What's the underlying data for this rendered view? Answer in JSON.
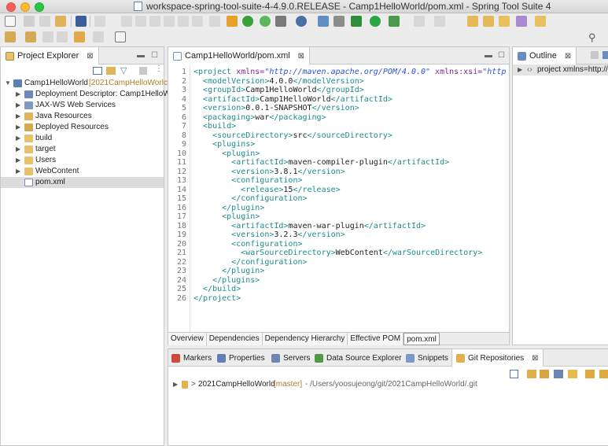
{
  "window": {
    "title": "workspace-spring-tool-suite-4-4.9.0.RELEASE - Camp1HelloWorld/pom.xml - Spring Tool Suite 4"
  },
  "project_explorer": {
    "tab_label": "Project Explorer",
    "close": "⊠",
    "root": {
      "label": "Camp1HelloWorld",
      "repo": "[2021CampHelloWorlc"
    },
    "items": [
      {
        "label": "Deployment Descriptor: Camp1HelloW"
      },
      {
        "label": "JAX-WS Web Services"
      },
      {
        "label": "Java Resources"
      },
      {
        "label": "Deployed Resources"
      },
      {
        "label": "build"
      },
      {
        "label": "target"
      },
      {
        "label": "Users"
      },
      {
        "label": "WebContent"
      },
      {
        "label": "pom.xml"
      }
    ]
  },
  "editor": {
    "tab_label": "Camp1HelloWorld/pom.xml",
    "close": "⊠",
    "lines": [
      {
        "n": "1",
        "c": [
          [
            "tag",
            "<project "
          ],
          [
            "attr",
            "xmlns="
          ],
          [
            "str",
            "\"http://maven.apache.org/POM/4.0.0\""
          ],
          [
            "attr",
            " xmlns:xsi="
          ],
          [
            "str",
            "\"http"
          ]
        ]
      },
      {
        "n": "2",
        "c": [
          [
            "txt",
            "  "
          ],
          [
            "tag",
            "<modelVersion>"
          ],
          [
            "txt",
            "4.0.0"
          ],
          [
            "tag",
            "</modelVersion>"
          ]
        ]
      },
      {
        "n": "3",
        "c": [
          [
            "txt",
            "  "
          ],
          [
            "tag",
            "<groupId>"
          ],
          [
            "txt",
            "Camp1HelloWorld"
          ],
          [
            "tag",
            "</groupId>"
          ]
        ]
      },
      {
        "n": "4",
        "c": [
          [
            "txt",
            "  "
          ],
          [
            "tag",
            "<artifactId>"
          ],
          [
            "txt",
            "Camp1HelloWorld"
          ],
          [
            "tag",
            "</artifactId>"
          ]
        ]
      },
      {
        "n": "5",
        "c": [
          [
            "txt",
            "  "
          ],
          [
            "tag",
            "<version>"
          ],
          [
            "txt",
            "0.0.1-SNAPSHOT"
          ],
          [
            "tag",
            "</version>"
          ]
        ]
      },
      {
        "n": "6",
        "c": [
          [
            "txt",
            "  "
          ],
          [
            "tag",
            "<packaging>"
          ],
          [
            "txt",
            "war"
          ],
          [
            "tag",
            "</packaging>"
          ]
        ]
      },
      {
        "n": "7",
        "c": [
          [
            "txt",
            "  "
          ],
          [
            "tag",
            "<build>"
          ]
        ]
      },
      {
        "n": "8",
        "c": [
          [
            "txt",
            "    "
          ],
          [
            "tag",
            "<sourceDirectory>"
          ],
          [
            "txt",
            "src"
          ],
          [
            "tag",
            "</sourceDirectory>"
          ]
        ]
      },
      {
        "n": "9",
        "c": [
          [
            "txt",
            "    "
          ],
          [
            "tag",
            "<plugins>"
          ]
        ]
      },
      {
        "n": "10",
        "c": [
          [
            "txt",
            "      "
          ],
          [
            "tag",
            "<plugin>"
          ]
        ]
      },
      {
        "n": "11",
        "c": [
          [
            "txt",
            "        "
          ],
          [
            "tag",
            "<artifactId>"
          ],
          [
            "txt",
            "maven-compiler-plugin"
          ],
          [
            "tag",
            "</artifactId>"
          ]
        ]
      },
      {
        "n": "12",
        "c": [
          [
            "txt",
            "        "
          ],
          [
            "tag",
            "<version>"
          ],
          [
            "txt",
            "3.8.1"
          ],
          [
            "tag",
            "</version>"
          ]
        ]
      },
      {
        "n": "13",
        "c": [
          [
            "txt",
            "        "
          ],
          [
            "tag",
            "<configuration>"
          ]
        ]
      },
      {
        "n": "14",
        "c": [
          [
            "txt",
            "          "
          ],
          [
            "tag",
            "<release>"
          ],
          [
            "txt",
            "15"
          ],
          [
            "tag",
            "</release>"
          ]
        ]
      },
      {
        "n": "15",
        "c": [
          [
            "txt",
            "        "
          ],
          [
            "tag",
            "</configuration>"
          ]
        ]
      },
      {
        "n": "16",
        "c": [
          [
            "txt",
            "      "
          ],
          [
            "tag",
            "</plugin>"
          ]
        ]
      },
      {
        "n": "17",
        "c": [
          [
            "txt",
            "      "
          ],
          [
            "tag",
            "<plugin>"
          ]
        ]
      },
      {
        "n": "18",
        "c": [
          [
            "txt",
            "        "
          ],
          [
            "tag",
            "<artifactId>"
          ],
          [
            "txt",
            "maven-war-plugin"
          ],
          [
            "tag",
            "</artifactId>"
          ]
        ]
      },
      {
        "n": "19",
        "c": [
          [
            "txt",
            "        "
          ],
          [
            "tag",
            "<version>"
          ],
          [
            "txt",
            "3.2.3"
          ],
          [
            "tag",
            "</version>"
          ]
        ]
      },
      {
        "n": "20",
        "c": [
          [
            "txt",
            "        "
          ],
          [
            "tag",
            "<configuration>"
          ]
        ]
      },
      {
        "n": "21",
        "c": [
          [
            "txt",
            "          "
          ],
          [
            "tag",
            "<warSourceDirectory>"
          ],
          [
            "txt",
            "WebContent"
          ],
          [
            "tag",
            "</warSourceDirectory>"
          ]
        ]
      },
      {
        "n": "22",
        "c": [
          [
            "txt",
            "        "
          ],
          [
            "tag",
            "</configuration>"
          ]
        ]
      },
      {
        "n": "23",
        "c": [
          [
            "txt",
            "      "
          ],
          [
            "tag",
            "</plugin>"
          ]
        ]
      },
      {
        "n": "24",
        "c": [
          [
            "txt",
            "    "
          ],
          [
            "tag",
            "</plugins>"
          ]
        ]
      },
      {
        "n": "25",
        "c": [
          [
            "txt",
            "  "
          ],
          [
            "tag",
            "</build>"
          ]
        ]
      },
      {
        "n": "26",
        "c": [
          [
            "tag",
            "</project>"
          ]
        ]
      }
    ],
    "bottom_tabs": [
      "Overview",
      "Dependencies",
      "Dependency Hierarchy",
      "Effective POM",
      "pom.xml"
    ]
  },
  "outline": {
    "tab_label": "Outline",
    "close": "⊠",
    "item": "project xmlns=http://"
  },
  "lower": {
    "tabs": [
      "Markers",
      "Properties",
      "Servers",
      "Data Source Explorer",
      "Snippets",
      "Git Repositories"
    ],
    "close": "⊠",
    "repo": {
      "prefix": ">",
      "name": "2021CampHelloWorld",
      "branch": "[master]",
      "path": "- /Users/yoosujeong/git/2021CampHelloWorld/.git"
    }
  },
  "colors": {
    "tag": "#1d8b8b",
    "attr": "#7a2a8a",
    "string": "#2b4fd8",
    "selection": "#dcdcdc"
  }
}
